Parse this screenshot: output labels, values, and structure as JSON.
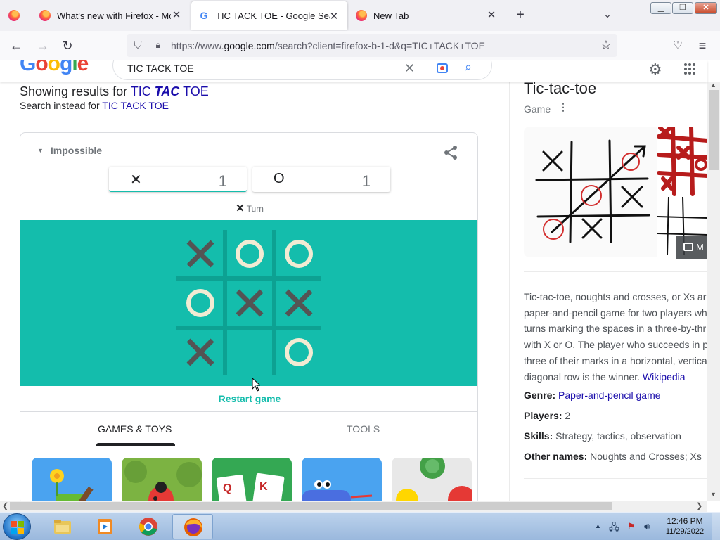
{
  "browser": {
    "tabs": [
      {
        "label": "",
        "icon": "firefox-icon"
      },
      {
        "label": "What's new with Firefox - More",
        "icon": "firefox-icon"
      },
      {
        "label": "TIC TACK TOE - Google Search",
        "icon": "google-icon",
        "active": true
      },
      {
        "label": "New Tab",
        "icon": "firefox-icon"
      }
    ],
    "new_tab_symbol": "+",
    "url_prefix": "https://www.",
    "url_host": "google.com",
    "url_rest": "/search?client=firefox-b-1-d&q=TIC+TACK+TOE"
  },
  "google": {
    "query": "TIC TACK TOE",
    "showing_prefix": "Showing results for ",
    "corrected_1": "TIC ",
    "corrected_2": "TAC",
    "corrected_3": " TOE",
    "instead_prefix": "Search instead for ",
    "instead_link": "TIC TACK TOE"
  },
  "game": {
    "difficulty": "Impossible",
    "score_x_symbol": "✕",
    "score_x": "1",
    "score_o_symbol": "O",
    "score_o": "1",
    "turn_symbol": "✕",
    "turn_label": "Turn",
    "board": [
      "X",
      "O",
      "O",
      "O",
      "X",
      "X",
      "X",
      "",
      "O"
    ],
    "restart_label": "Restart game",
    "tab_games": "GAMES & TOYS",
    "tab_tools": "TOOLS",
    "colors": {
      "board_bg": "#14bdac",
      "grid": "#0da192",
      "x_mark": "#545454",
      "o_mark": "#f2ebd3"
    }
  },
  "knowledge_panel": {
    "title": "Tic-tac-toe",
    "subtitle": "Game",
    "more_images": "M",
    "description_lines": [
      "Tic-tac-toe, noughts and crosses, or Xs ar",
      "paper-and-pencil game for two players wh",
      "turns marking the spaces in a three-by-thr",
      "with X or O. The player who succeeds in p",
      "three of their marks in a horizontal, vertica",
      "diagonal row is the winner. "
    ],
    "source_link": "Wikipedia",
    "facts": [
      {
        "label": "Genre:",
        "value": "Paper-and-pencil game",
        "link": true
      },
      {
        "label": "Players:",
        "value": "2",
        "link": false
      },
      {
        "label": "Skills:",
        "value": "Strategy, tactics, observation",
        "link": false
      },
      {
        "label": "Other names:",
        "value": "Noughts and Crosses; Xs",
        "link": false
      }
    ]
  },
  "taskbar": {
    "time": "12:46 PM",
    "date": "11/29/2022"
  }
}
